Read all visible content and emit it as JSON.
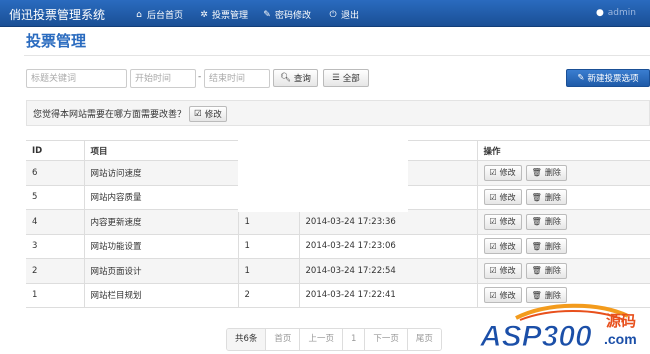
{
  "nav": {
    "brand": "俏迅投票管理系统",
    "items": [
      {
        "label": "后台首页",
        "icon": "home-icon"
      },
      {
        "label": "投票管理",
        "icon": "cogs-icon"
      },
      {
        "label": "密码修改",
        "icon": "wrench-icon"
      },
      {
        "label": "退出",
        "icon": "power-icon"
      }
    ],
    "user": "admin"
  },
  "page_title": "投票管理",
  "search": {
    "keyword_placeholder": "标题关键词",
    "start_placeholder": "开始时间",
    "separator": "-",
    "end_placeholder": "结束时间",
    "query_label": "查询",
    "all_label": "全部",
    "new_label": "新建投票选项"
  },
  "question": {
    "text": "您觉得本网站需要在哪方面需要改善？",
    "edit_label": "修改"
  },
  "table": {
    "headers": [
      "ID",
      "项目",
      "",
      "",
      "操作"
    ],
    "rows": [
      {
        "id": "6",
        "item": "网站访问速度",
        "count": "",
        "time": ""
      },
      {
        "id": "5",
        "item": "网站内容质量",
        "count": "",
        "time": ""
      },
      {
        "id": "4",
        "item": "内容更新速度",
        "count": "1",
        "time": "2014-03-24 17:23:36"
      },
      {
        "id": "3",
        "item": "网站功能设置",
        "count": "1",
        "time": "2014-03-24 17:23:06"
      },
      {
        "id": "2",
        "item": "网站页面设计",
        "count": "1",
        "time": "2014-03-24 17:22:54"
      },
      {
        "id": "1",
        "item": "网站栏目规划",
        "count": "2",
        "time": "2014-03-24 17:22:41"
      }
    ],
    "edit_label": "修改",
    "delete_label": "删除"
  },
  "pager": {
    "total": "共6条",
    "first": "首页",
    "prev": "上一页",
    "page": "1",
    "next": "下一页",
    "last": "尾页"
  },
  "watermark": {
    "text": "ASP300",
    "suffix": "源码",
    "domain": ".com"
  }
}
